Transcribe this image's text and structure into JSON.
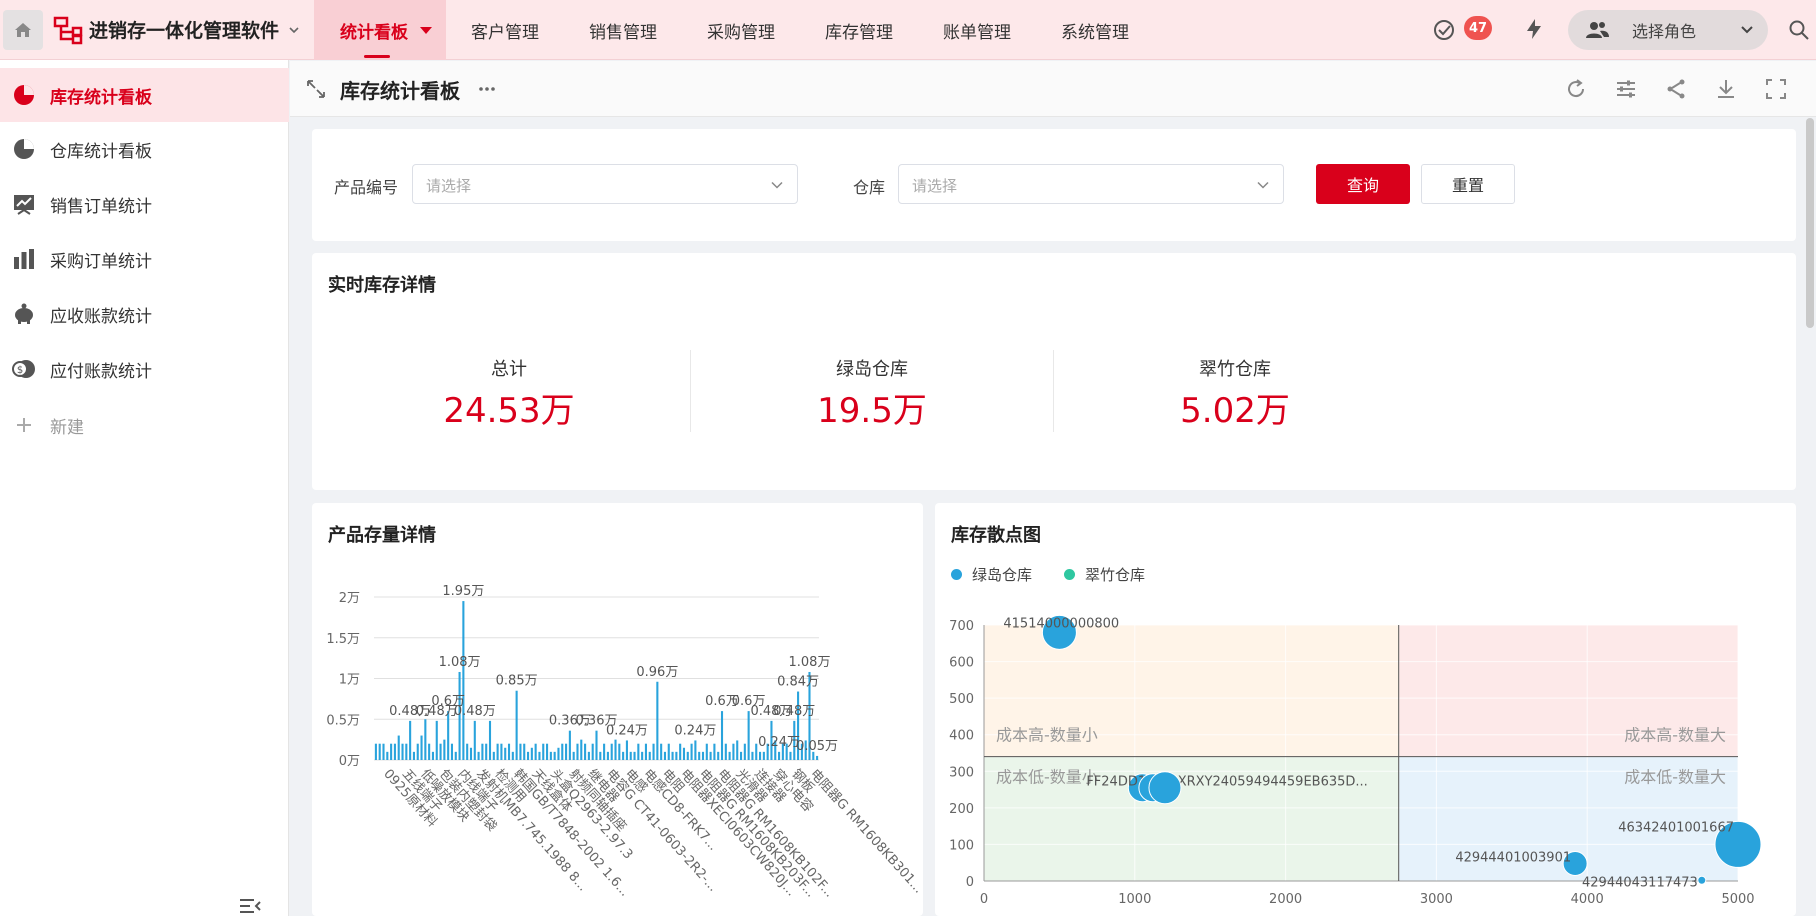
{
  "app": {
    "title": "进销存一体化管理软件",
    "nav": [
      {
        "label": "统计看板",
        "active": true
      },
      {
        "label": "客户管理"
      },
      {
        "label": "销售管理"
      },
      {
        "label": "采购管理"
      },
      {
        "label": "库存管理"
      },
      {
        "label": "账单管理"
      },
      {
        "label": "系统管理"
      }
    ],
    "notification_count": "47",
    "role_placeholder": "选择角色",
    "accent_color": "#d9001b"
  },
  "sidebar": {
    "items": [
      {
        "label": "库存统计看板",
        "icon": "pie-chart-icon",
        "active": true
      },
      {
        "label": "仓库统计看板",
        "icon": "pie-chart-icon"
      },
      {
        "label": "销售订单统计",
        "icon": "line-chart-icon"
      },
      {
        "label": "采购订单统计",
        "icon": "bar-chart-icon"
      },
      {
        "label": "应收账款统计",
        "icon": "piggy-bank-icon"
      },
      {
        "label": "应付账款统计",
        "icon": "coins-icon"
      }
    ],
    "new_label": "新建"
  },
  "page": {
    "title": "库存统计看板"
  },
  "filters": {
    "product_label": "产品编号",
    "product_placeholder": "请选择",
    "warehouse_label": "仓库",
    "warehouse_placeholder": "请选择",
    "query_button": "查询",
    "reset_button": "重置"
  },
  "realtime": {
    "title": "实时库存详情",
    "stats": [
      {
        "label": "总计",
        "value": "24.53万"
      },
      {
        "label": "绿岛仓库",
        "value": "19.5万"
      },
      {
        "label": "翠竹仓库",
        "value": "5.02万"
      }
    ]
  },
  "product_card": {
    "title": "产品存量详情"
  },
  "scatter_card": {
    "title": "库存散点图"
  },
  "chart_data": [
    {
      "type": "bar",
      "title": "产品存量详情",
      "y_tick_labels": [
        "0万",
        "0.5万",
        "1万",
        "1.5万",
        "2万"
      ],
      "ylim": [
        0,
        20000
      ],
      "grid": true,
      "color": "#29a3dc",
      "values": [
        2000,
        2000,
        2000,
        1000,
        2000,
        2000,
        3000,
        2000,
        2000,
        4800,
        1000,
        2000,
        3000,
        5000,
        2000,
        1000,
        4800,
        2000,
        2500,
        6000,
        2000,
        1000,
        10800,
        19500,
        2000,
        1500,
        4800,
        1000,
        2000,
        2000,
        4800,
        1000,
        2000,
        2000,
        1500,
        2000,
        1000,
        8500,
        2000,
        2000,
        1000,
        1500,
        2000,
        1000,
        2000,
        2000,
        1000,
        1000,
        1500,
        2000,
        2000,
        3600,
        1000,
        2000,
        2500,
        2000,
        1000,
        2000,
        3600,
        1000,
        2000,
        1000,
        2000,
        2500,
        2000,
        1000,
        2400,
        1000,
        1000,
        2000,
        1000,
        2000,
        1000,
        2000,
        9600,
        2000,
        1000,
        2000,
        1000,
        1000,
        2000,
        1500,
        1000,
        2000,
        2400,
        1000,
        1000,
        2000,
        1000,
        2000,
        1000,
        6000,
        2000,
        1000,
        2000,
        2400,
        1000,
        2000,
        6000,
        1000,
        2000,
        1000,
        1000,
        2000,
        4800,
        2400,
        1000,
        2000,
        2000,
        1000,
        4800,
        8400,
        2000,
        2400,
        10800,
        1000,
        500
      ],
      "data_labels": [
        {
          "i": 23,
          "text": "1.95万"
        },
        {
          "i": 22,
          "text": "1.08万"
        },
        {
          "i": 19,
          "text": "0.6万"
        },
        {
          "i": 9,
          "text": "0.48万"
        },
        {
          "i": 16,
          "text": "0.48万"
        },
        {
          "i": 26,
          "text": "0.48万"
        },
        {
          "i": 37,
          "text": "0.85万"
        },
        {
          "i": 51,
          "text": "0.36万"
        },
        {
          "i": 58,
          "text": "0.36万"
        },
        {
          "i": 66,
          "text": "0.24万"
        },
        {
          "i": 74,
          "text": "0.96万"
        },
        {
          "i": 84,
          "text": "0.24万"
        },
        {
          "i": 91,
          "text": "0.6万"
        },
        {
          "i": 98,
          "text": "0.6万"
        },
        {
          "i": 104,
          "text": "0.48万"
        },
        {
          "i": 106,
          "text": "0.24万"
        },
        {
          "i": 110,
          "text": "0.48万"
        },
        {
          "i": 111,
          "text": "0.84万"
        },
        {
          "i": 114,
          "text": "1.08万"
        },
        {
          "i": 116,
          "text": "0.05万"
        }
      ],
      "x_tick_labels": [
        "0925原材料",
        "五线端子",
        "低噪放模块",
        "包装内塑封袋",
        "内线端子",
        "发射机MB7.745.1988 8...",
        "检测用",
        "韩国GB/T7848-2002 1.6...",
        "天线盒体",
        "头盒Q2963-2.97.3",
        "射频同轴插座",
        "继电器",
        "电容G CT41-0603-2R2-...",
        "电感",
        "电感CD8-FRK7...",
        "电阻",
        "电阻器XECI0603CW820J...",
        "电阻器G RM1608KB203F...",
        "电阻器G RM1608KB102F...",
        "光滑器",
        "连接器",
        "穿心电容",
        "钢板",
        "电阻器G RM1608KB301..."
      ]
    },
    {
      "type": "scatter",
      "title": "库存散点图",
      "xlim": [
        0,
        5000
      ],
      "ylim": [
        0,
        700
      ],
      "x_ticks": [
        0,
        1000,
        2000,
        3000,
        4000,
        5000
      ],
      "y_ticks": [
        0,
        100,
        200,
        300,
        400,
        500,
        600,
        700
      ],
      "split": {
        "x": 2750,
        "y": 340
      },
      "quadrants": [
        {
          "label": "成本高-数量小",
          "color": "#fff4e8"
        },
        {
          "label": "成本高-数量大",
          "color": "#fde9e9"
        },
        {
          "label": "成本低-数量小",
          "color": "#eaf5ea"
        },
        {
          "label": "成本低-数量大",
          "color": "#e6f2fb"
        }
      ],
      "series": [
        {
          "name": "绿岛仓库",
          "color": "#29a3dc",
          "points": [
            {
              "x": 500,
              "y": 680,
              "size": 34,
              "label": "41514000000800"
            },
            {
              "x": 1050,
              "y": 255,
              "size": 28,
              "label": "FF24DD1FAFBXRXY24059494459EB635D..."
            },
            {
              "x": 1120,
              "y": 255,
              "size": 28,
              "label": ""
            },
            {
              "x": 1200,
              "y": 255,
              "size": 32,
              "label": ""
            },
            {
              "x": 3920,
              "y": 48,
              "size": 24,
              "label": "42944401003901"
            },
            {
              "x": 5000,
              "y": 100,
              "size": 46,
              "label": "46342401001667"
            },
            {
              "x": 4760,
              "y": 2,
              "size": 8,
              "label": "42944043117473"
            }
          ]
        },
        {
          "name": "翠竹仓库",
          "color": "#2ec7a0",
          "points": []
        }
      ]
    }
  ]
}
